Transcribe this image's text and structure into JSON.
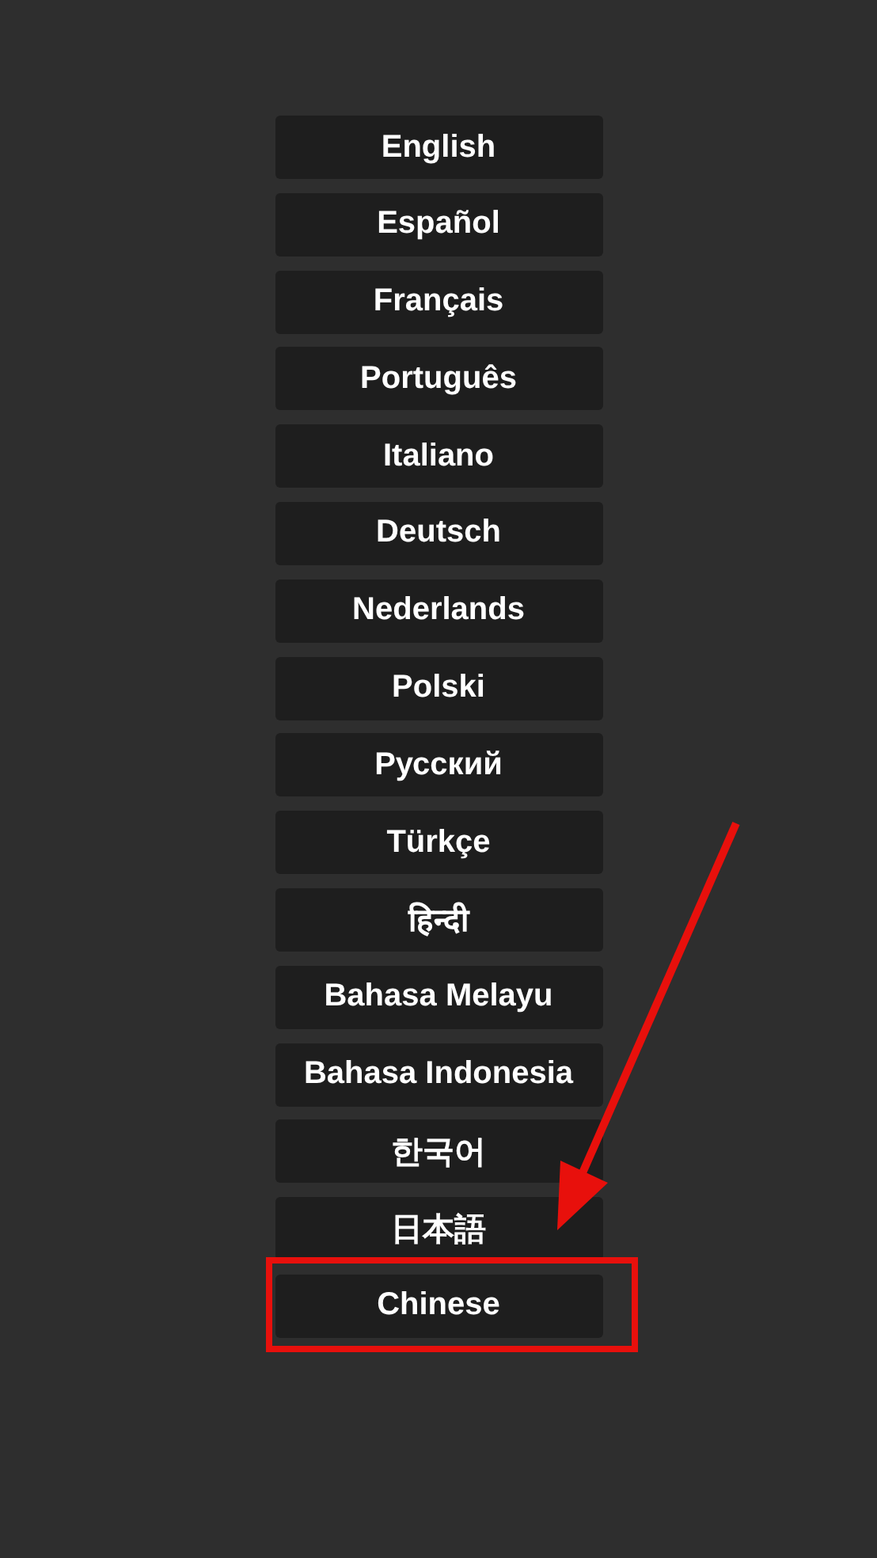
{
  "languages": [
    {
      "label": "English",
      "highlighted": false
    },
    {
      "label": "Español",
      "highlighted": false
    },
    {
      "label": "Français",
      "highlighted": false
    },
    {
      "label": "Português",
      "highlighted": false
    },
    {
      "label": "Italiano",
      "highlighted": false
    },
    {
      "label": "Deutsch",
      "highlighted": false
    },
    {
      "label": "Nederlands",
      "highlighted": false
    },
    {
      "label": "Polski",
      "highlighted": false
    },
    {
      "label": "Русский",
      "highlighted": false
    },
    {
      "label": "Türkçe",
      "highlighted": false
    },
    {
      "label": "हिन्दी",
      "highlighted": false
    },
    {
      "label": "Bahasa Melayu",
      "highlighted": false
    },
    {
      "label": "Bahasa Indonesia",
      "highlighted": false
    },
    {
      "label": "한국어",
      "highlighted": false
    },
    {
      "label": "日本語",
      "highlighted": false
    },
    {
      "label": "Chinese",
      "highlighted": true
    }
  ]
}
